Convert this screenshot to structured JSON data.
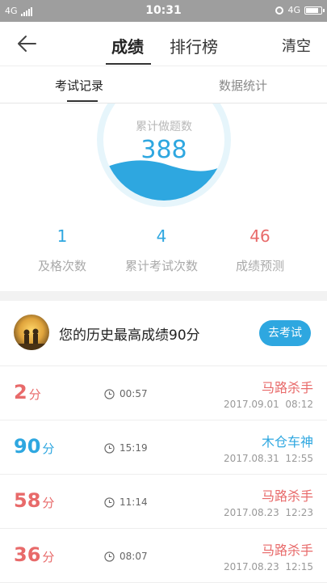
{
  "status_bar": {
    "network_left": "4G",
    "time": "10:31",
    "network_right": "4G",
    "battery_level_percent": 90
  },
  "nav": {
    "tabs": [
      {
        "label": "成绩",
        "active": true
      },
      {
        "label": "排行榜",
        "active": false
      }
    ],
    "clear_label": "清空"
  },
  "sub_tabs": [
    {
      "label": "考试记录",
      "active": true
    },
    {
      "label": "数据统计",
      "active": false
    }
  ],
  "summary": {
    "label": "累计做题数",
    "value": "388",
    "stats": [
      {
        "value": "1",
        "label": "及格次数",
        "color": "#2ea7e0"
      },
      {
        "value": "4",
        "label": "累计考试次数",
        "color": "#2ea7e0"
      },
      {
        "value": "46",
        "label": "成绩预测",
        "color": "#e86a6a"
      }
    ]
  },
  "best": {
    "text": "您的历史最高成绩90分",
    "button": "去考试"
  },
  "records": [
    {
      "score": "2",
      "unit": "分",
      "color": "red",
      "duration": "00:57",
      "title": "马路杀手",
      "date": "2017.09.01",
      "time": "08:12"
    },
    {
      "score": "90",
      "unit": "分",
      "color": "blue",
      "duration": "15:19",
      "title": "木仓车神",
      "date": "2017.08.31",
      "time": "12:55"
    },
    {
      "score": "58",
      "unit": "分",
      "color": "red",
      "duration": "11:14",
      "title": "马路杀手",
      "date": "2017.08.23",
      "time": "12:23"
    },
    {
      "score": "36",
      "unit": "分",
      "color": "red",
      "duration": "08:07",
      "title": "马路杀手",
      "date": "2017.08.23",
      "time": "12:15"
    }
  ],
  "colors": {
    "accent": "#2ea7e0",
    "fail": "#e86a6a"
  }
}
